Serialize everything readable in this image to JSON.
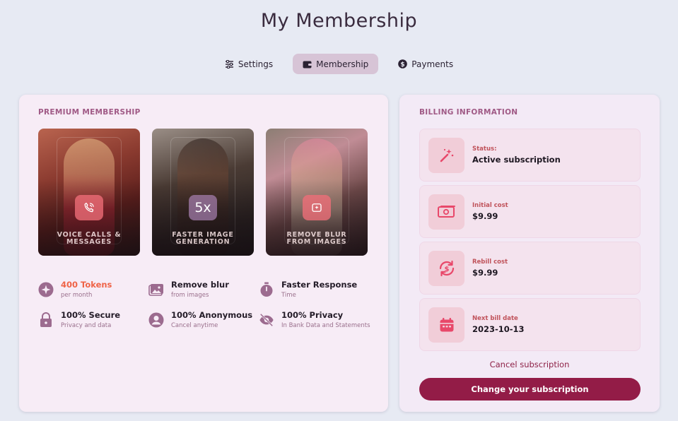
{
  "page": {
    "title": "My Membership"
  },
  "tabs": [
    {
      "label": "Settings",
      "icon": "sliders-icon"
    },
    {
      "label": "Membership",
      "icon": "wallet-icon",
      "active": true
    },
    {
      "label": "Payments",
      "icon": "dollar-circle-icon"
    }
  ],
  "membership": {
    "section_label": "PREMIUM MEMBERSHIP",
    "cards": [
      {
        "caption": "VOICE CALLS & MESSAGES",
        "icon": "phone-icon"
      },
      {
        "caption": "FASTER IMAGE GENERATION",
        "badge_text": "5x"
      },
      {
        "caption": "REMOVE BLUR FROM IMAGES",
        "icon": "image-sparkle-icon"
      }
    ],
    "features": [
      {
        "title": "400 Tokens",
        "subtitle": "per month",
        "icon": "sparkle-icon"
      },
      {
        "title": "Remove blur",
        "subtitle": "from images",
        "icon": "image-icon"
      },
      {
        "title": "Faster Response",
        "subtitle": "Time",
        "icon": "stopwatch-icon"
      },
      {
        "title": "100% Secure",
        "subtitle": "Privacy and data",
        "icon": "lock-icon"
      },
      {
        "title": "100% Anonymous",
        "subtitle": "Cancel anytime",
        "icon": "user-circle-icon"
      },
      {
        "title": "100% Privacy",
        "subtitle": "In Bank Data and Statements",
        "icon": "eye-off-icon"
      }
    ]
  },
  "billing": {
    "section_label": "BILLING INFORMATION",
    "items": [
      {
        "label": "Status:",
        "value": "Active subscription",
        "icon": "magic-wand-icon"
      },
      {
        "label": "Initial cost",
        "value": "$9.99",
        "icon": "money-icon"
      },
      {
        "label": "Rebill cost",
        "value": "$9.99",
        "icon": "refresh-dollar-icon"
      },
      {
        "label": "Next bill date",
        "value": "2023-10-13",
        "icon": "calendar-icon"
      }
    ],
    "cancel_label": "Cancel subscription",
    "change_label": "Change your subscription"
  },
  "colors": {
    "background": "#e7eaf3",
    "accent": "#931c47",
    "token_highlight": "#ef6347",
    "active_tab": "#d7c4d6"
  }
}
